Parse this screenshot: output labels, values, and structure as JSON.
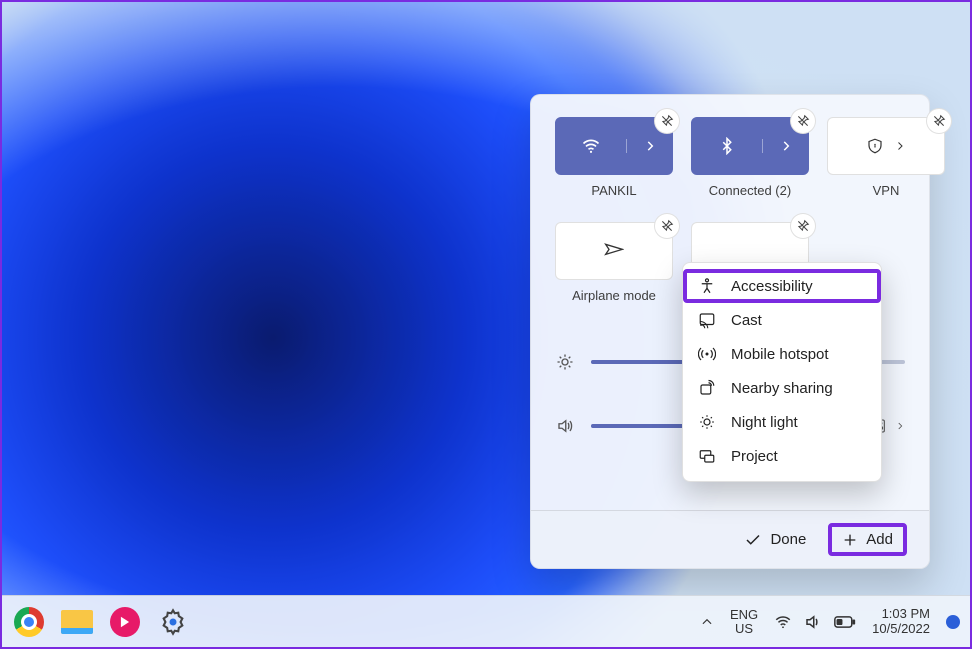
{
  "tiles": {
    "wifi": {
      "label": "PANKIL",
      "active": true
    },
    "bluetooth": {
      "label": "Connected (2)",
      "active": true
    },
    "vpn": {
      "label": "VPN",
      "active": false
    },
    "airplane": {
      "label": "Airplane mode",
      "active": false
    }
  },
  "sliders": {
    "brightness_pct": 42,
    "volume_pct": 100
  },
  "footer": {
    "done": "Done",
    "add": "Add"
  },
  "popup": {
    "items": [
      {
        "key": "accessibility",
        "label": "Accessibility",
        "highlighted": true
      },
      {
        "key": "cast",
        "label": "Cast"
      },
      {
        "key": "mobile_hotspot",
        "label": "Mobile hotspot"
      },
      {
        "key": "nearby_sharing",
        "label": "Nearby sharing"
      },
      {
        "key": "night_light",
        "label": "Night light"
      },
      {
        "key": "project",
        "label": "Project"
      }
    ]
  },
  "taskbar": {
    "lang_top": "ENG",
    "lang_bottom": "US",
    "time": "1:03 PM",
    "date": "10/5/2022"
  },
  "colors": {
    "accent": "#5b69b7",
    "highlight": "#7a2be0"
  }
}
